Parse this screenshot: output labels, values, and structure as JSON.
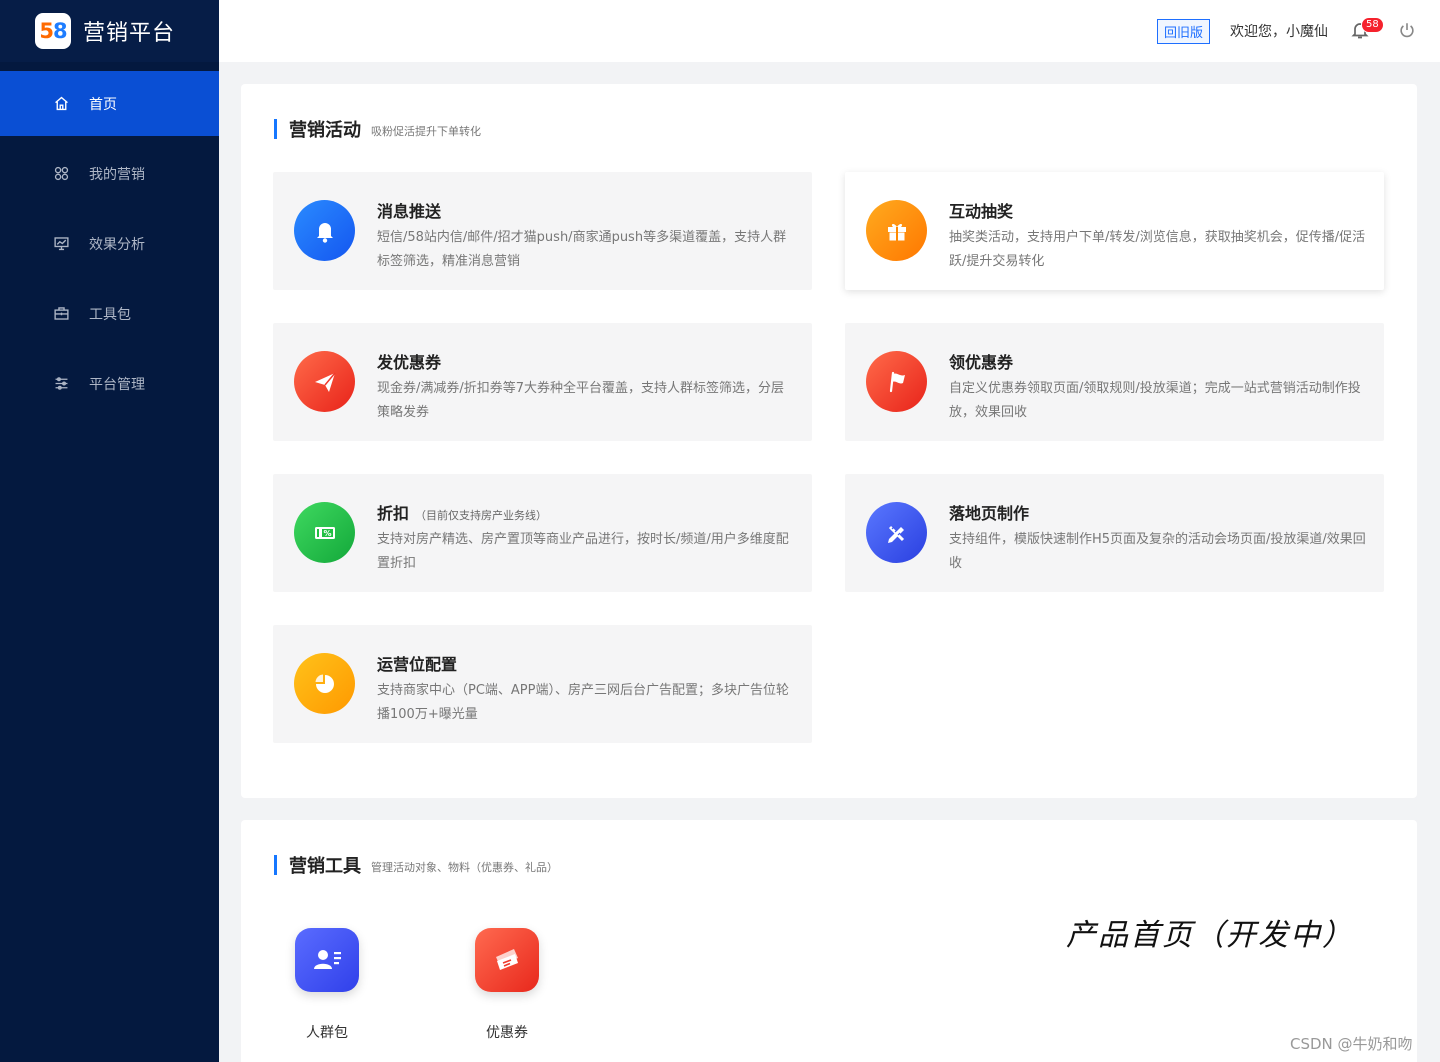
{
  "app": {
    "logo_digit_1": "5",
    "logo_digit_2": "8",
    "title": "营销平台"
  },
  "sidebar": {
    "items": [
      {
        "label": "首页",
        "icon": "home-icon",
        "active": true
      },
      {
        "label": "我的营销",
        "icon": "apps-icon",
        "active": false
      },
      {
        "label": "效果分析",
        "icon": "analytics-icon",
        "active": false
      },
      {
        "label": "工具包",
        "icon": "toolbox-icon",
        "active": false
      },
      {
        "label": "平台管理",
        "icon": "settings-list-icon",
        "active": false
      }
    ]
  },
  "header": {
    "old_version": "回旧版",
    "welcome": "欢迎您，小魔仙",
    "notification_count": "58"
  },
  "activities": {
    "title": "营销活动",
    "subtitle": "吸粉促活提升下单转化",
    "cards": [
      {
        "title": "消息推送",
        "note": "",
        "desc": "短信/58站内信/邮件/招才猫push/商家通push等多渠道覆盖，支持人群标签筛选，精准消息营销",
        "icon": "bell-icon",
        "color": "#1e6fff"
      },
      {
        "title": "互动抽奖",
        "note": "",
        "desc": "抽奖类活动，支持用户下单/转发/浏览信息，获取抽奖机会，促传播/促活跃/提升交易转化",
        "icon": "gift-icon",
        "color": "#ff8a00"
      },
      {
        "title": "发优惠券",
        "note": "",
        "desc": "现金券/满减券/折扣券等7大券种全平台覆盖，支持人群标签筛选，分层策略发券",
        "icon": "paper-plane-icon",
        "color": "#f5392e"
      },
      {
        "title": "领优惠券",
        "note": "",
        "desc": "自定义优惠券领取页面/领取规则/投放渠道；完成一站式营销活动制作投放，效果回收",
        "icon": "flag-icon",
        "color": "#f53a2e"
      },
      {
        "title": "折扣",
        "note": "（目前仅支持房产业务线）",
        "desc": "支持对房产精选、房产置顶等商业产品进行，按时长/频道/用户多维度配置折扣",
        "icon": "discount-ticket-icon",
        "color": "#22c043"
      },
      {
        "title": "落地页制作",
        "note": "",
        "desc": "支持组件，模版快速制作H5页面及复杂的活动会场页面/投放渠道/效果回收",
        "icon": "ruler-pencil-icon",
        "color": "#3a55ef"
      },
      {
        "title": "运营位配置",
        "note": "",
        "desc": "支持商家中心（PC端、APP端）、房产三网后台广告配置；多块广告位轮播100万+曝光量",
        "icon": "pie-chart-icon",
        "color": "#ffad0a"
      }
    ]
  },
  "tools": {
    "title": "营销工具",
    "subtitle": "管理活动对象、物料（优惠券、礼品）",
    "items": [
      {
        "label": "人群包",
        "icon": "user-group-icon",
        "color": "#3e5cf6"
      },
      {
        "label": "优惠券",
        "icon": "coupon-icon",
        "color": "#f5433a"
      }
    ]
  },
  "overlay_note": "产品首页（开发中）",
  "watermark": "CSDN @牛奶和吻"
}
